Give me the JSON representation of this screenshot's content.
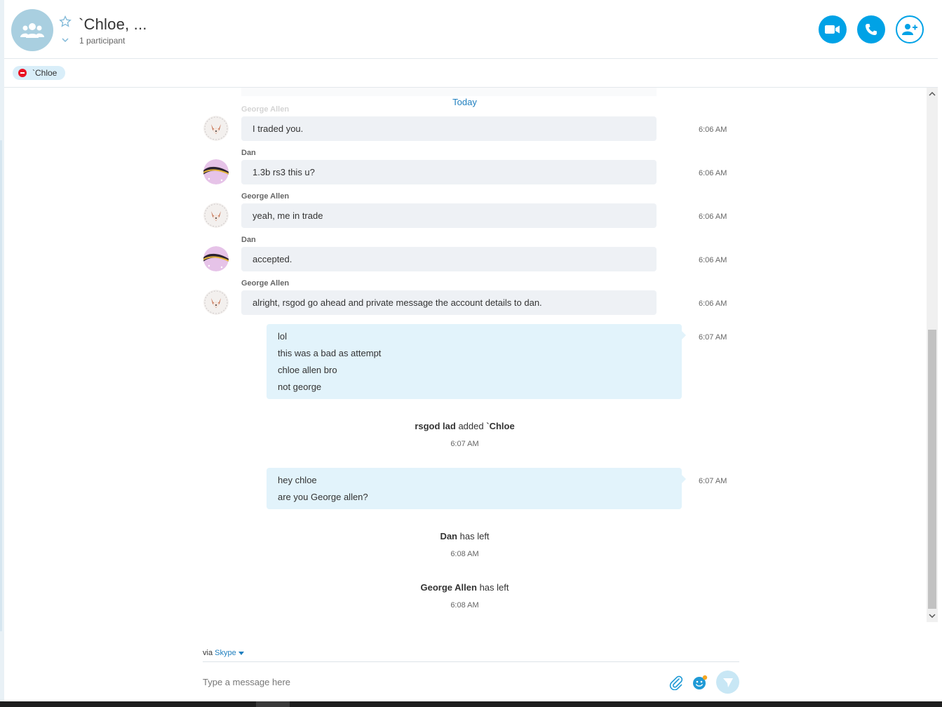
{
  "header": {
    "title": "`Chloe, ...",
    "subtitle": "1 participant",
    "video_call_icon": "video-camera-icon",
    "audio_call_icon": "phone-icon",
    "add_people_icon": "add-person-icon"
  },
  "participants": [
    {
      "name": "`Chloe",
      "status": "do-not-disturb"
    }
  ],
  "conversation": {
    "day_divider": "Today",
    "faded_name": "George Allen",
    "messages": [
      {
        "sender": "",
        "text": "I traded you.",
        "time": "6:06 AM"
      },
      {
        "sender": "Dan",
        "text": "1.3b rs3 this u?",
        "time": "6:06 AM"
      },
      {
        "sender": "George Allen",
        "text": "yeah, me in trade",
        "time": "6:06 AM"
      },
      {
        "sender": "Dan",
        "text": "accepted.",
        "time": "6:06 AM"
      },
      {
        "sender": "George Allen",
        "text": "alright, rsgod go ahead and private message the account details to dan.",
        "time": "6:06 AM"
      }
    ],
    "outgoing_1": {
      "lines": [
        "lol",
        "this was a bad as attempt",
        "chloe allen bro",
        "not george"
      ],
      "time": "6:07 AM"
    },
    "event_added": {
      "actor": "rsgod lad",
      "verb": "added",
      "target": "`Chloe",
      "time": "6:07 AM"
    },
    "outgoing_2": {
      "lines": [
        "hey chloe",
        "are you George allen?"
      ],
      "time": "6:07 AM"
    },
    "event_dan_left": {
      "actor": "Dan",
      "verb": "has left",
      "time": "6:08 AM"
    },
    "event_george_left": {
      "actor": "George Allen",
      "verb": "has left",
      "time": "6:08 AM"
    }
  },
  "compose": {
    "via_label": "via",
    "via_service": "Skype",
    "placeholder": "Type a message here"
  },
  "colors": {
    "accent": "#00a2e6",
    "link": "#1f7fbf",
    "incoming_bubble": "#eef1f5",
    "outgoing_bubble": "#e2f3fb",
    "dnd": "#e81123"
  }
}
